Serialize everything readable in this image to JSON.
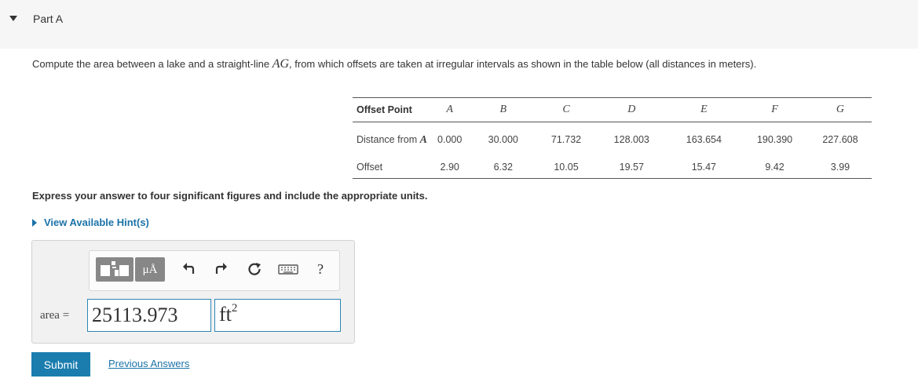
{
  "part": {
    "title": "Part A"
  },
  "problem": {
    "text_before": "Compute the area between a lake and a straight-line ",
    "line_name": "AG",
    "text_after": ", from which offsets are taken at irregular intervals as shown in the table below (all distances in meters)."
  },
  "table": {
    "header_label": "Offset Point",
    "columns": [
      "A",
      "B",
      "C",
      "D",
      "E",
      "F",
      "G"
    ],
    "distance_label": "Distance from",
    "distance_point": "A",
    "distances": [
      "0.000",
      "30.000",
      "71.732",
      "128.003",
      "163.654",
      "190.390",
      "227.608"
    ],
    "offset_label": "Offset",
    "offsets": [
      "2.90",
      "6.32",
      "10.05",
      "19.57",
      "15.47",
      "9.42",
      "3.99"
    ]
  },
  "instruction": "Express your answer to four significant figures and include the appropriate units.",
  "hint_label": "View Available Hint(s)",
  "answer": {
    "label": "area =",
    "value": "25113.973",
    "unit": "ft",
    "unit_exponent": "2",
    "toolbar": {
      "units_label": "μÅ",
      "help_label": "?",
      "icons": [
        "templates-icon",
        "units-icon",
        "undo-icon",
        "redo-icon",
        "reset-icon",
        "keyboard-icon",
        "help-icon"
      ]
    }
  },
  "buttons": {
    "submit": "Submit",
    "previous_answers": "Previous Answers"
  }
}
